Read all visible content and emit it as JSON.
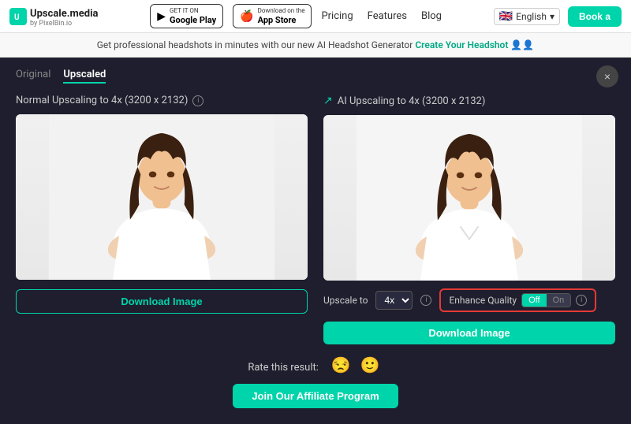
{
  "navbar": {
    "logo_text": "Upscale.media",
    "logo_sub": "by PixelBin.io",
    "google_play_label": "GET IT ON",
    "google_play_store": "Google Play",
    "app_store_label": "Download on the",
    "app_store_name": "App Store",
    "links": [
      "Pricing",
      "Features",
      "Blog"
    ],
    "lang": "English",
    "book_btn": "Book a"
  },
  "promo": {
    "text": "Get professional headshots in minutes with our new AI Headshot Generator",
    "cta": "Create Your Headshot"
  },
  "tabs": [
    {
      "label": "Original",
      "active": false
    },
    {
      "label": "Upscaled",
      "active": true
    }
  ],
  "left_panel": {
    "title": "Normal Upscaling to 4x (3200 x 2132)",
    "download_btn": "Download Image"
  },
  "right_panel": {
    "ai_label": "AI Upscaling to 4x (3200 x 2132)",
    "upscale_label": "Upscale to",
    "upscale_value": "4x",
    "enhance_label": "Enhance Quality",
    "toggle_off": "Off",
    "toggle_on": "On",
    "download_btn": "Download Image"
  },
  "rating": {
    "label": "Rate this result:",
    "emoji_sad": "😒",
    "emoji_neutral": "🙂"
  },
  "affiliate": {
    "btn_label": "Join Our Affiliate Program"
  },
  "close_btn": "×",
  "info_icon": "i",
  "chevron": "▾"
}
